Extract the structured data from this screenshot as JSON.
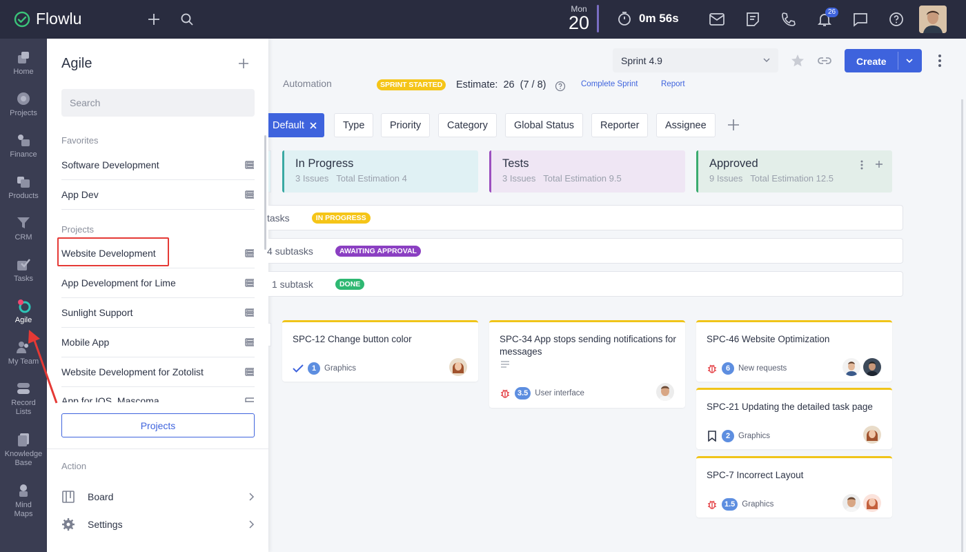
{
  "app": {
    "name": "Flowlu"
  },
  "topbar": {
    "date_day": "Mon",
    "date_num": "20",
    "timer": "0m 56s",
    "notif_count": "26",
    "icons": [
      "plus-icon",
      "search-icon",
      "timer-icon",
      "mail-icon",
      "notes-icon",
      "phone-icon",
      "bell-icon",
      "chat-icon",
      "help-icon"
    ]
  },
  "sidebar": {
    "items": [
      {
        "label": "Home"
      },
      {
        "label": "Projects"
      },
      {
        "label": "Finance"
      },
      {
        "label": "Products"
      },
      {
        "label": "CRM"
      },
      {
        "label": "Tasks"
      },
      {
        "label": "Agile",
        "active": true
      },
      {
        "label": "My Team"
      },
      {
        "label": "Record Lists"
      },
      {
        "label": "Knowledge Base"
      },
      {
        "label": "Mind Maps"
      }
    ]
  },
  "panel": {
    "title": "Agile",
    "search_placeholder": "Search",
    "favorites_label": "Favorites",
    "favorites": [
      "Software Development",
      "App Dev"
    ],
    "projects_label": "Projects",
    "projects": [
      "Website Development",
      "App Development for Lime",
      "Sunlight Support",
      "Mobile App",
      "Website Development for Zotolist",
      "App for IOS. Mascoma"
    ],
    "projects_button": "Projects",
    "action_label": "Action",
    "actions": [
      {
        "label": "Board"
      },
      {
        "label": "Settings"
      }
    ]
  },
  "main": {
    "sprint": "Sprint 4.9",
    "create_label": "Create",
    "tab_automation": "Automation",
    "sprint_status": "SPRINT STARTED",
    "estimate_label": "Estimate:",
    "estimate_value": "26",
    "estimate_detail": "(7 / 8)",
    "complete_sprint": "Complete Sprint",
    "report": "Report",
    "filters": {
      "default": "Default",
      "items": [
        "Type",
        "Priority",
        "Category",
        "Global Status",
        "Reporter",
        "Assignee"
      ]
    },
    "columns": [
      {
        "title": "In Progress",
        "issues": "3 Issues",
        "estimation": "Total Estimation 4",
        "color": "#e0f1f4",
        "border": "#3aa9a3"
      },
      {
        "title": "Tests",
        "issues": "3 Issues",
        "estimation": "Total Estimation 9.5",
        "color": "#efe6f4",
        "border": "#9c4fbf"
      },
      {
        "title": "Approved",
        "issues": "9 Issues",
        "estimation": "Total Estimation 12.5",
        "color": "#e3eee9",
        "border": "#3bab6f"
      }
    ],
    "swimlanes": [
      {
        "text": "tasks",
        "status": "IN PROGRESS",
        "color": "#f5c518"
      },
      {
        "text": "4 subtasks",
        "status": "AWAITING APPROVAL",
        "color": "#8b3fc2"
      },
      {
        "text": "1 subtask",
        "status": "DONE",
        "color": "#2eb872"
      }
    ],
    "cards": [
      {
        "id": "SPC-12",
        "title": "Change button color",
        "estimate": "1",
        "category": "Graphics"
      },
      {
        "id": "SPC-34",
        "title": "App stops sending notifications for messages",
        "estimate": "3.5",
        "category": "User interface"
      },
      {
        "id": "SPC-46",
        "title": "Website Optimization",
        "estimate": "6",
        "category": "New requests"
      },
      {
        "id": "SPC-21",
        "title": "Updating the detailed task page",
        "estimate": "2",
        "category": "Graphics"
      },
      {
        "id": "SPC-7",
        "title": "Incorrect Layout",
        "estimate": "1.5",
        "category": "Graphics"
      }
    ]
  }
}
